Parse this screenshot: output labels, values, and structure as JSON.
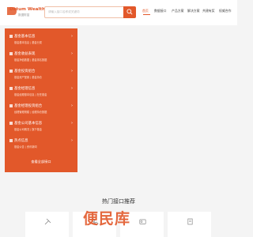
{
  "header": {
    "logo_text": "Datum Wealth",
    "logo_sub": "数据財富",
    "search_placeholder": "请输入接口名称或关键词",
    "nav": [
      {
        "label": "首页",
        "active": true
      },
      {
        "label": "数据接口",
        "active": false
      },
      {
        "label": "产品方案",
        "active": false
      },
      {
        "label": "解决方案",
        "active": false
      },
      {
        "label": "共建有奖",
        "active": false
      },
      {
        "label": "权威合作",
        "active": false
      }
    ]
  },
  "sidebar": {
    "items": [
      {
        "title": "基金基本信息",
        "subs": "基金基本信息 | 基金分类"
      },
      {
        "title": "基金收益表现",
        "subs": "基金净值数据 | 基金排名数据"
      },
      {
        "title": "基金投资组合",
        "subs": "基金资产配置 | 基金持仓"
      },
      {
        "title": "基金经理信息",
        "subs": "基金经理基本信息 | 在任基金"
      },
      {
        "title": "基金经理投资组合",
        "subs": "经理管理规模 | 经理持仓数据"
      },
      {
        "title": "基金公司基本信息",
        "subs": "基金公司概况 | 旗下基金"
      },
      {
        "title": "热点信息",
        "subs": "基金公告 | 资讯新闻"
      }
    ],
    "more_label": "查看全部接口"
  },
  "section": {
    "title": "热门接口推荐"
  },
  "watermark": "便民库",
  "colors": {
    "accent": "#e2582a",
    "background": "#f4f4f4"
  }
}
